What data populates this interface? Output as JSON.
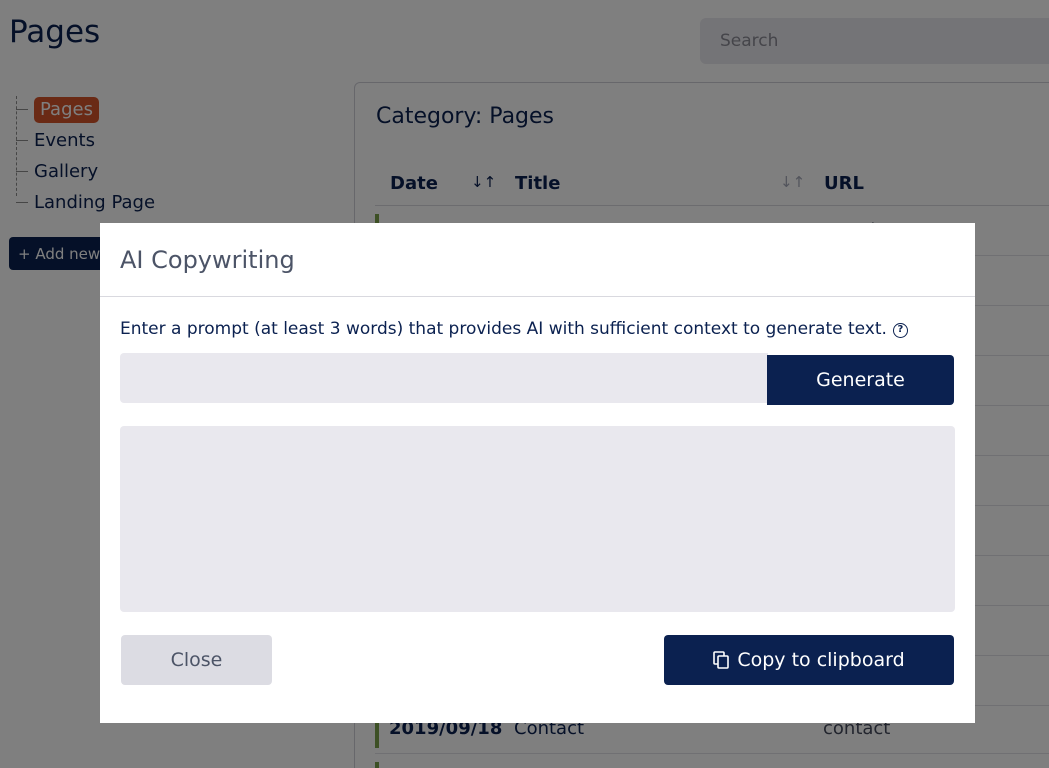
{
  "page": {
    "title": "Pages",
    "search_placeholder": "Search"
  },
  "sidebar": {
    "items": [
      {
        "label": "Pages",
        "active": true
      },
      {
        "label": "Events",
        "active": false
      },
      {
        "label": "Gallery",
        "active": false
      },
      {
        "label": "Landing Page",
        "active": false
      }
    ],
    "add_button_label": "+ Add new c"
  },
  "panel": {
    "title": "Category: Pages",
    "columns": {
      "date": "Date",
      "title": "Title",
      "url": "URL"
    },
    "rows": [
      {
        "date": "",
        "title": "",
        "url": "round"
      },
      {
        "date": "2019/09/18",
        "title": "Contact",
        "url": "contact"
      }
    ]
  },
  "modal": {
    "title": "AI Copywriting",
    "prompt_label": "Enter a prompt (at least 3 words) that provides AI with sufficient context to generate text.",
    "prompt_value": "",
    "generate_label": "Generate",
    "output_value": "",
    "close_label": "Close",
    "copy_label": "Copy to clipboard"
  },
  "icons": {
    "help": "question-circle",
    "copy": "copy",
    "sort_active": "sort-desc",
    "sort_inactive": "sort"
  },
  "colors": {
    "primary": "#0b2150",
    "accent": "#d4552b",
    "status_green": "#7aa04a",
    "input_bg": "#e9e8ee"
  }
}
